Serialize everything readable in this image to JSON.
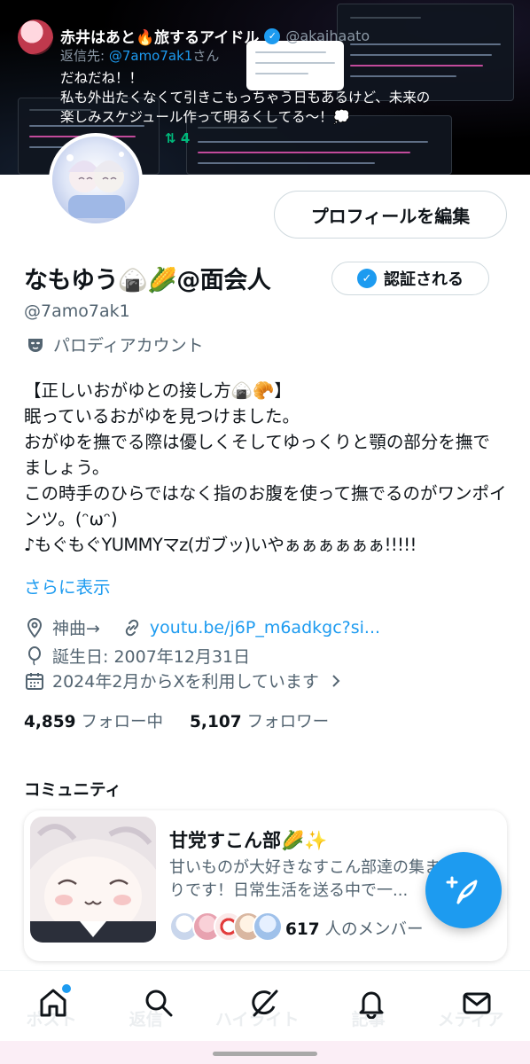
{
  "banner": {
    "tweet_name": "赤井はあと🔥旅するアイドル",
    "tweet_handle": "@akaihaato",
    "reply_prefix": "返信先: ",
    "reply_mention": "@7amo7ak1",
    "reply_suffix": "さん",
    "tweet_text_line1": "だねだね！！",
    "tweet_text_line2": "私も外出たくなくて引きこもっちゃう日もあるけど、未来の楽しみスケジュール作って明るくしてる〜！💭",
    "retweet_count": "4"
  },
  "profile": {
    "edit_button": "プロフィールを編集",
    "display_name": "なもゆう🍙🌽@面会人",
    "get_verified_button": "認証される",
    "handle": "@7amo7ak1",
    "parody_label": "パロディアカウント",
    "bio_lines": [
      "【正しいおがゆとの接し方🍙🥐】",
      "眠っているおがゆを見つけました。",
      "おがゆを撫でる際は優しくそしてゆっくりと顎の部分を撫でましょう。",
      "この時手のひらではなく指のお腹を使って撫でるのがワンポインツ。(ᵔωᵔ)",
      "♪もぐもぐYUMMYマz(ガブッ)いやぁぁぁぁぁぁ!!!!!"
    ],
    "show_more": "さらに表示",
    "location": "神曲→",
    "website": "youtu.be/j6P_m6adkgc?si...",
    "birthday": "誕生日: 2007年12月31日",
    "joined": "2024年2月からXを利用しています",
    "following_count": "4,859",
    "following_label": "フォロー中",
    "followers_count": "5,107",
    "followers_label": "フォロワー"
  },
  "community": {
    "heading": "コミュニティ",
    "name": "甘党すこん部🌽✨",
    "description": "甘いものが大好きなすこん部達の集まりです！日常生活を送る中で一...",
    "member_count": "617",
    "member_suffix": " 人のメンバー"
  },
  "tabs": [
    "ポスト",
    "返信",
    "ハイライト",
    "記事",
    "メディア"
  ],
  "nav": [
    "home-icon",
    "search-icon",
    "grok-icon",
    "notifications-icon",
    "messages-icon"
  ],
  "colors": {
    "accent": "#1d9bf0",
    "text": "#0f1419",
    "secondary": "#536471"
  }
}
